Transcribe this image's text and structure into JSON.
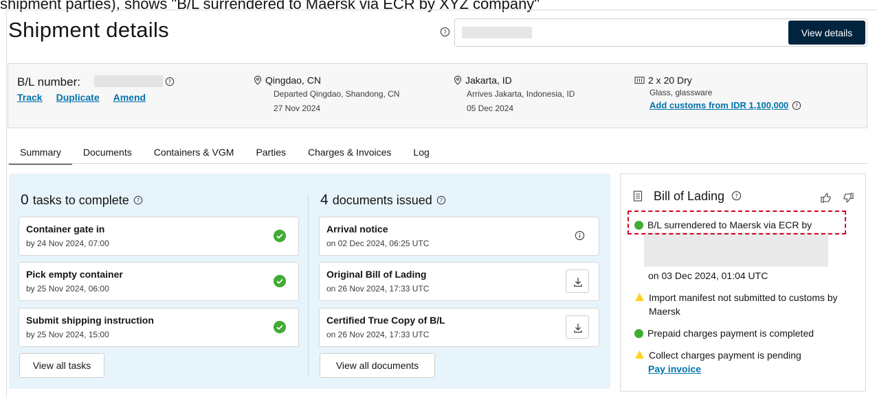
{
  "caption": "shipment parties), shows \"B/L surrendered to Maersk via ECR by XYZ company\"",
  "header": {
    "title": "Shipment details",
    "view_details_label": "View details"
  },
  "bl": {
    "label": "B/L number:",
    "links": [
      "Track",
      "Duplicate",
      "Amend"
    ],
    "origin": {
      "city": "Qingdao, CN",
      "status": "Departed Qingdao, Shandong, CN",
      "date": "27 Nov 2024"
    },
    "destination": {
      "city": "Jakarta, ID",
      "status": "Arrives Jakarta, Indonesia, ID",
      "date": "05 Dec 2024"
    },
    "container": {
      "type": "2 x 20 Dry",
      "commodity": "Glass, glassware",
      "customs_link": "Add customs from IDR 1,100,000"
    }
  },
  "tabs": [
    "Summary",
    "Documents",
    "Containers & VGM",
    "Parties",
    "Charges & Invoices",
    "Log"
  ],
  "tasks": {
    "count": "0",
    "title": "tasks to complete",
    "items": [
      {
        "title": "Container gate in",
        "sub": "by 24 Nov 2024, 07:00"
      },
      {
        "title": "Pick empty container",
        "sub": "by 25 Nov 2024, 06:00"
      },
      {
        "title": "Submit shipping instruction",
        "sub": "by 25 Nov 2024, 15:00"
      }
    ],
    "view_all": "View all tasks"
  },
  "documents": {
    "count": "4",
    "title": "documents issued",
    "items": [
      {
        "title": "Arrival notice",
        "sub": "on 02 Dec 2024, 06:25 UTC"
      },
      {
        "title": "Original Bill of Lading",
        "sub": "on 26 Nov 2024, 17:33 UTC"
      },
      {
        "title": "Certified True Copy of B/L",
        "sub": "on 26 Nov 2024, 17:33 UTC"
      }
    ],
    "view_all": "View all documents"
  },
  "bol": {
    "title": "Bill of Lading",
    "surrendered": "B/L surrendered to Maersk via ECR by",
    "surrendered_date": "on 03 Dec 2024, 01:04 UTC",
    "manifest": "Import manifest not submitted to customs by Maersk",
    "prepaid": "Prepaid charges payment is completed",
    "collect": "Collect charges payment is pending",
    "pay_link": "Pay invoice"
  },
  "colors": {
    "primary": "#00243d",
    "link": "#0073ab",
    "success": "#40ab35",
    "warning": "#ffd21e",
    "panel": "#e8f4fb"
  }
}
